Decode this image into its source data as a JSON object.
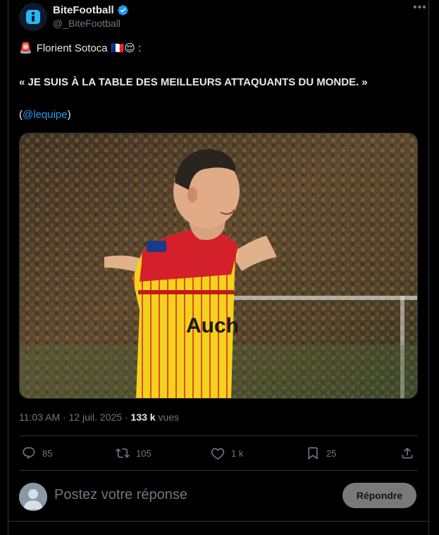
{
  "author": {
    "name": "BiteFootball",
    "handle": "@_BiteFootball",
    "verified": true
  },
  "tweet": {
    "line1_emoji": "🚨",
    "line1_text": "Florient Sotoca",
    "line1_flag": "🇫🇷",
    "line1_emoji2": "😌",
    "line1_suffix": " :",
    "quote": "« JE SUIS À LA TABLE DES MEILLEURS ATTAQUANTS DU MONDE. »",
    "source_open": "(",
    "source_mention": "@lequipe",
    "source_close": ")"
  },
  "meta": {
    "time": "11:03 AM",
    "sep1": " · ",
    "date": "12 juil. 2025",
    "sep2": " · ",
    "views": "133 k",
    "views_label": " vues"
  },
  "actions": {
    "replies": "85",
    "retweets": "105",
    "likes": "1 k",
    "bookmarks": "25"
  },
  "reply": {
    "placeholder": "Postez votre réponse",
    "button": "Répondre"
  },
  "media": {
    "jersey_sponsor": "Auch"
  },
  "colors": {
    "accent": "#1d9bf0",
    "muted": "#71767b",
    "jersey_yellow": "#f2d21b",
    "jersey_red": "#d4202a"
  }
}
